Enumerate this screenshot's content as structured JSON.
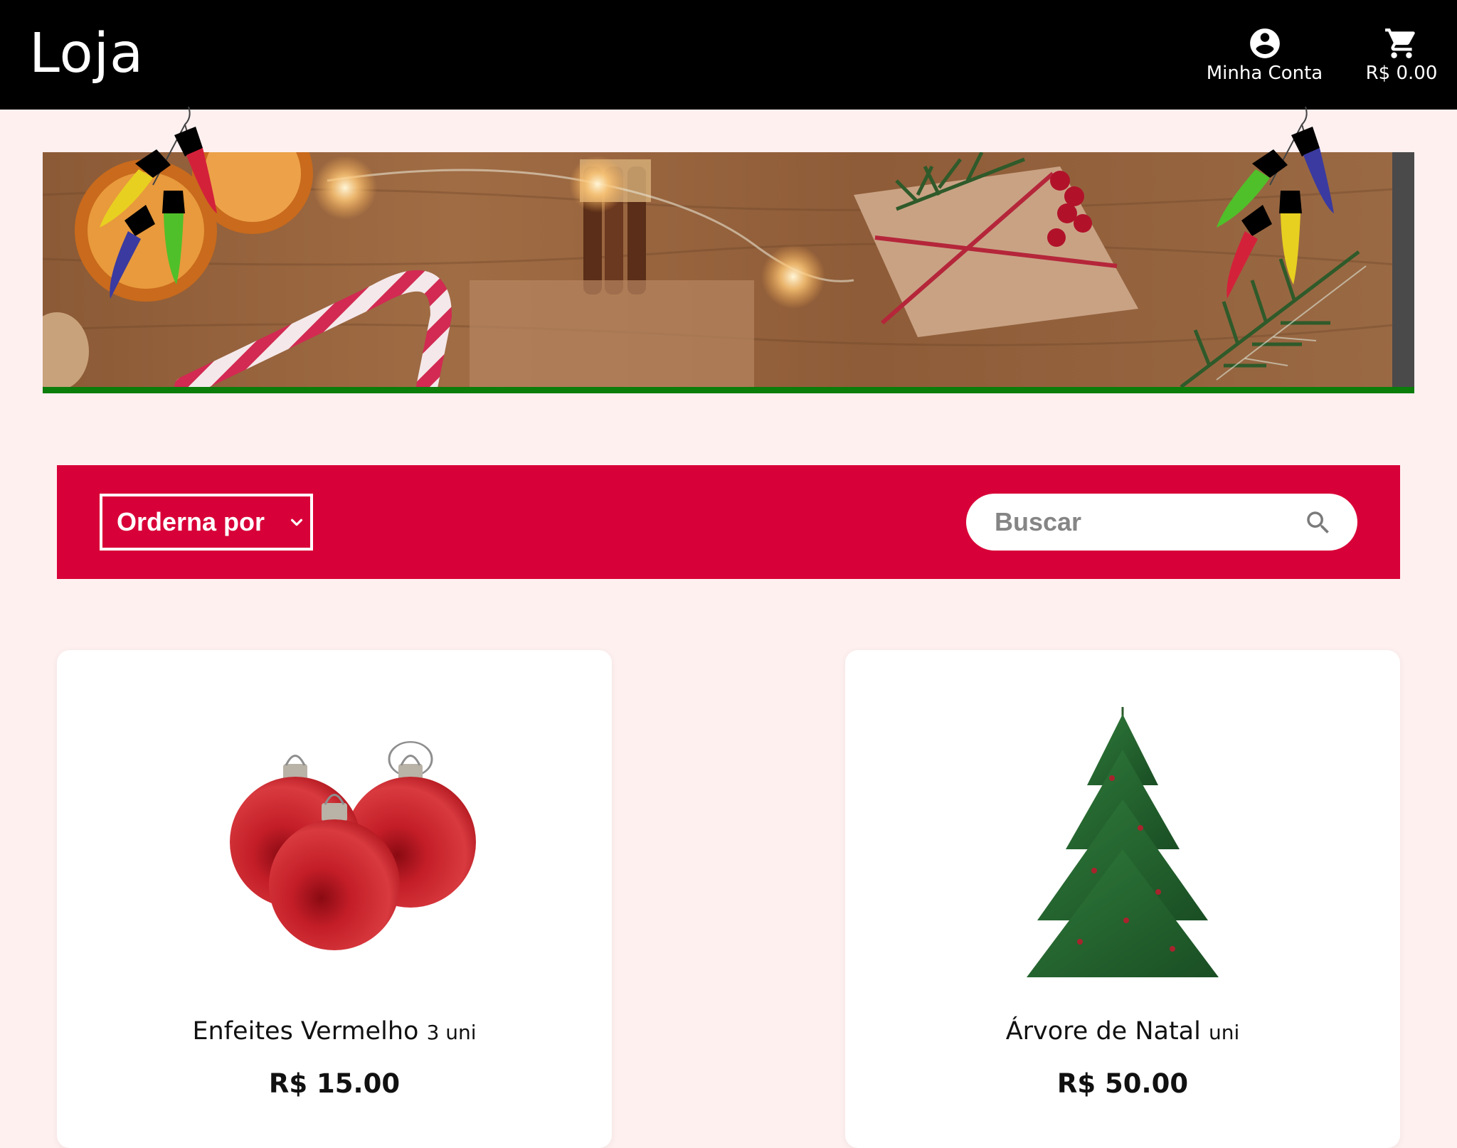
{
  "header": {
    "brand": "Loja",
    "account_label": "Minha Conta",
    "account_icon": "account-circle-icon",
    "cart_total": "R$ 0.00",
    "cart_icon": "shopping-cart-icon"
  },
  "toolbar": {
    "sort_label": "Orderna por",
    "search_placeholder": "Buscar",
    "search_value": ""
  },
  "products": [
    {
      "name": "Enfeites Vermelho",
      "unit": "3 uni",
      "price": "R$ 15.00",
      "image": "red-ornaments-image"
    },
    {
      "name": "Árvore de Natal",
      "unit": "uni",
      "price": "R$ 50.00",
      "image": "christmas-tree-image"
    }
  ],
  "colors": {
    "header_bg": "#000000",
    "page_bg": "#fff0f0",
    "toolbar_bg": "#d80038",
    "banner_accent": "#0b7d0b"
  }
}
